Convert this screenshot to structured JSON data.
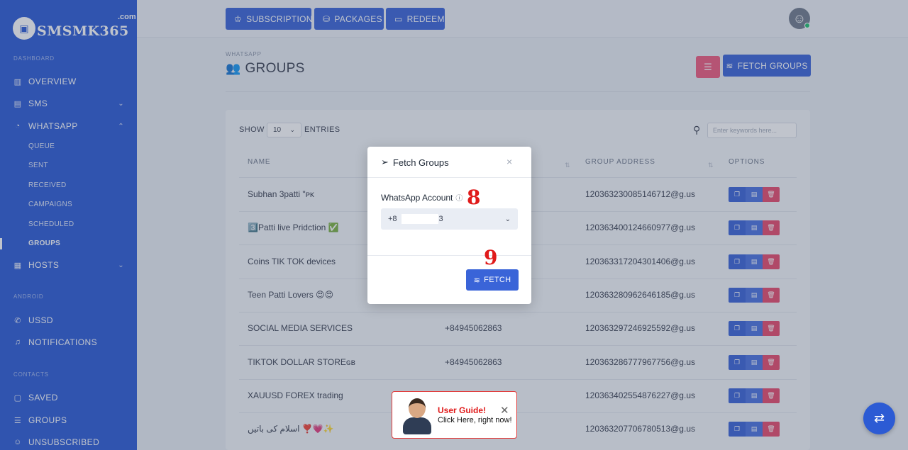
{
  "brand": {
    "name": "SMSMK365",
    "tld": ".com"
  },
  "sidebar": {
    "section_dashboard": "DASHBOARD",
    "section_android": "ANDROID",
    "section_contacts": "CONTACTS",
    "items": {
      "overview": "OVERVIEW",
      "sms": "SMS",
      "whatsapp": "WHATSAPP",
      "hosts": "HOSTS",
      "ussd": "USSD",
      "notifications": "NOTIFICATIONS",
      "saved": "SAVED",
      "groups": "GROUPS",
      "unsubscribed": "UNSUBSCRIBED"
    },
    "whatsapp_sub": [
      "QUEUE",
      "SENT",
      "RECEIVED",
      "CAMPAIGNS",
      "SCHEDULED",
      "GROUPS"
    ]
  },
  "topbar": {
    "subscription": "SUBSCRIPTION",
    "packages": "PACKAGES",
    "redeem": "REDEEM"
  },
  "page": {
    "crumb": "WHATSAPP",
    "title": "GROUPS",
    "fetch_groups_button": "FETCH GROUPS"
  },
  "table": {
    "show": "SHOW",
    "entries_value": "10",
    "entries": "ENTRIES",
    "search_placeholder": "Enter keywords here...",
    "columns": {
      "name": "NAME",
      "group_address": "GROUP ADDRESS",
      "options": "OPTIONS"
    },
    "rows": [
      {
        "name": "Subhan 3patti \"ᴘᴋ",
        "account": "",
        "address": "120363230085146712@g.us"
      },
      {
        "name": "3️⃣Patti live Pridction ✅",
        "account": "",
        "address": "120363400124660977@g.us"
      },
      {
        "name": "Coins TIK TOK devices",
        "account": "",
        "address": "120363317204301406@g.us"
      },
      {
        "name": "Teen Patti Lovers 😍😍",
        "account": "",
        "address": "120363280962646185@g.us"
      },
      {
        "name": "SOCIAL MEDIA SERVICES",
        "account": "+84945062863",
        "address": "120363297246925592@g.us"
      },
      {
        "name": "TIKTOK DOLLAR STOREɢʙ",
        "account": "+84945062863",
        "address": "120363286777967756@g.us"
      },
      {
        "name": "XAUUSD FOREX trading",
        "account": "",
        "address": "120363402554876227@g.us"
      },
      {
        "name": "اسلام کی باتیں ❣️💗✨",
        "account": "",
        "address": "120363207706780513@g.us"
      }
    ]
  },
  "modal": {
    "title": "Fetch Groups",
    "field_label": "WhatsApp Account",
    "account_prefix": "+8",
    "account_suffix": "3",
    "step_8": "8",
    "step_9": "9",
    "fetch_button": "FETCH"
  },
  "guide": {
    "title": "User Guide!",
    "subtitle": "Click Here, right now!"
  }
}
